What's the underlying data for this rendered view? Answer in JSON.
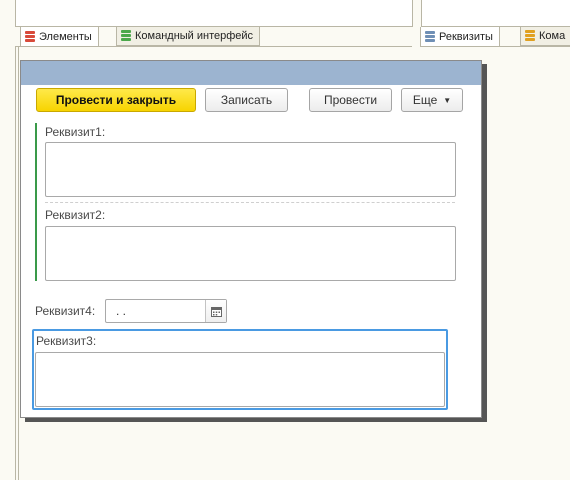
{
  "tabs_left": [
    {
      "label": "Элементы",
      "active": true
    },
    {
      "label": "Командный интерфейс",
      "active": false
    }
  ],
  "tabs_right": [
    {
      "label": "Реквизиты",
      "active": true
    },
    {
      "label": "Кома",
      "active": false
    }
  ],
  "toolbar": {
    "post_close_label": "Провести и закрыть",
    "save_label": "Записать",
    "post_label": "Провести",
    "more_label": "Еще"
  },
  "fields": {
    "rekvizit1_label": "Реквизит1:",
    "rekvizit2_label": "Реквизит2:",
    "rekvizit4_label": "Реквизит4:",
    "rekvizit4_value": ". .",
    "rekvizit3_label": "Реквизит3:"
  },
  "colors": {
    "header": "#9cb4d0",
    "primary_button": "#f7d400",
    "group_bar": "#3a9a4a",
    "focus_border": "#4a9ae2"
  }
}
